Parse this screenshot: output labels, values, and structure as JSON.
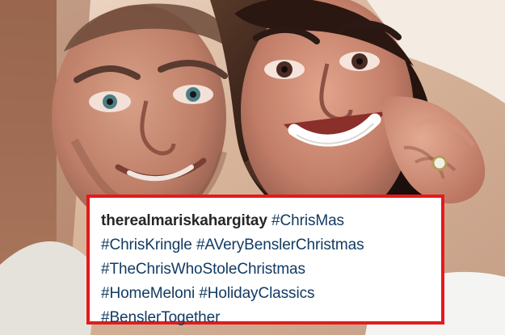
{
  "caption": {
    "username": "therealmariskahargitay",
    "hashtags": [
      "#ChrisMas",
      "#ChrisKringle",
      "#AVeryBenslerChristmas",
      "#TheChrisWhoStoleChristmas",
      "#HomeMeloni",
      "#HolidayClassics",
      "#BenslerTogether"
    ]
  },
  "colors": {
    "highlight_border": "#e31b1b",
    "hashtag_text": "#123b63",
    "username_text": "#262626"
  }
}
